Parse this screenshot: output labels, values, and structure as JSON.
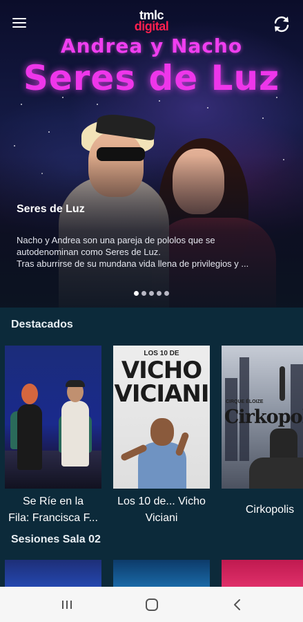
{
  "header": {
    "logo_top": "tmlc",
    "logo_bottom": "digital",
    "menu_icon": "hamburger-menu-icon",
    "refresh_icon": "refresh-icon"
  },
  "hero": {
    "poster_line_1": "Andrea y Nacho",
    "poster_line_2": "Seres de Luz",
    "title": "Seres de Luz",
    "description_lines": [
      "Nacho y Andrea son una pareja de pololos que se",
      "autodenominan como Seres de Luz.",
      "Tras aburrirse de su mundana vida llena de privilegios y ..."
    ],
    "slide_count": 5,
    "active_slide": 0
  },
  "sections": [
    {
      "title": "Destacados",
      "items": [
        {
          "title_lines": [
            "Se Ríe en la",
            "Fila: Francisca F..."
          ]
        },
        {
          "title_lines": [
            "Los 10 de... Vicho",
            "Viciani"
          ],
          "poster_top": "LOS 10 DE",
          "poster_name_1": "VICHO",
          "poster_name_2": "VICIANI"
        },
        {
          "title_lines": [
            "Cirkopolis"
          ],
          "poster_small": "CIRQUE ÉLOIZE",
          "poster_big": "Cirkopoli"
        }
      ]
    },
    {
      "title": "Sesiones Sala 02"
    }
  ],
  "navbar": {
    "recent_icon": "recent-apps-icon",
    "home_icon": "home-icon",
    "back_icon": "back-icon"
  },
  "colors": {
    "background": "#0c2a3a",
    "hero_title": "#ee36ea",
    "logo_accent": "#ff1f4f",
    "navbar": "#f6f6f6"
  }
}
